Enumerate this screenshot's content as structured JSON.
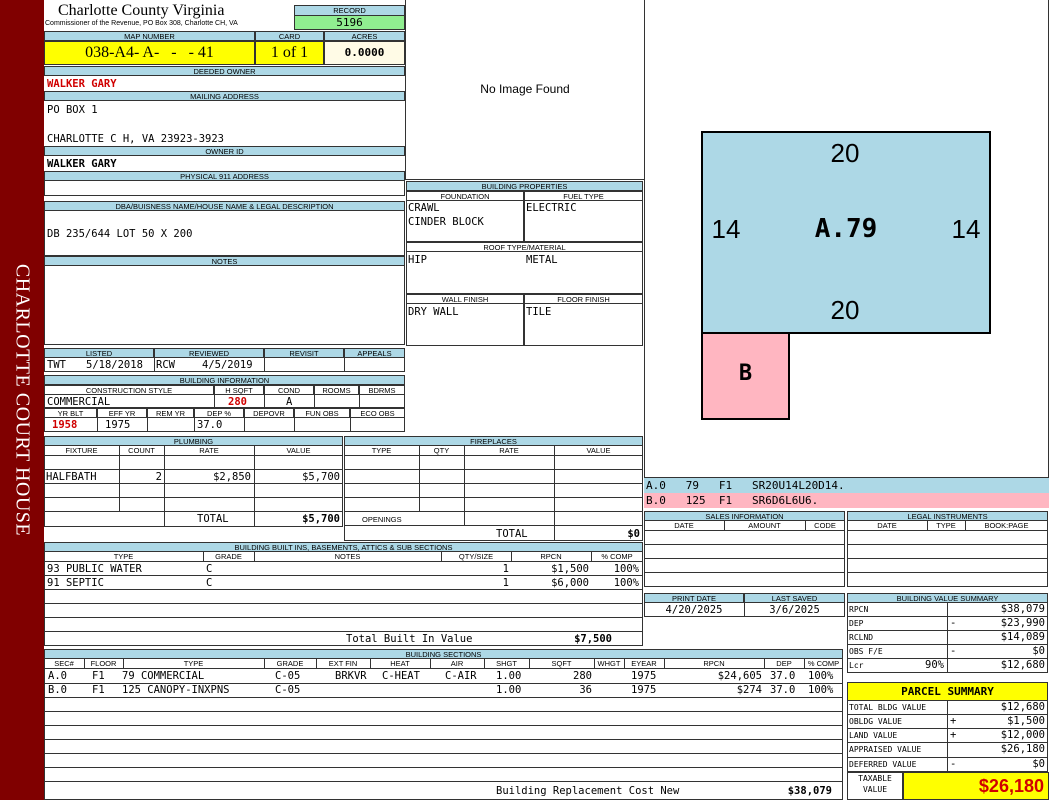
{
  "side_banner": "CHARLOTTE COURT HOUSE",
  "header": {
    "county": "Charlotte County Virginia",
    "commissioner": "Commissioner of the Revenue, PO Box 308, Charlotte CH, VA",
    "record_label": "RECORD",
    "record": "5196",
    "map_number_label": "MAP NUMBER",
    "map_number": "038-A4- A-   -   - 41",
    "card_label": "CARD",
    "card": "1 of 1",
    "acres_label": "ACRES",
    "acres": "0.0000"
  },
  "owner": {
    "deeded_label": "DEEDED OWNER",
    "deeded": "WALKER GARY",
    "mailing_label": "MAILING ADDRESS",
    "mailing_line1": "PO BOX 1",
    "mailing_line2": "CHARLOTTE C H, VA 23923-3923",
    "owner_id_label": "OWNER ID",
    "owner_id": "WALKER GARY",
    "physical_label": "PHYSICAL 911 ADDRESS",
    "physical": "",
    "dba_label": "DBA/BUISNESS NAME/HOUSE NAME & LEGAL DESCRIPTION",
    "dba": "DB 235/644 LOT 50 X 200",
    "notes_label": "NOTES"
  },
  "image": {
    "text": "No Image Found"
  },
  "building_properties": {
    "title": "BUILDING PROPERTIES",
    "foundation_label": "FOUNDATION",
    "foundation1": "CRAWL",
    "foundation2": "CINDER BLOCK",
    "fuel_label": "FUEL TYPE",
    "fuel": "ELECTRIC",
    "roof_label": "ROOF TYPE/MATERIAL",
    "roof_type": "HIP",
    "roof_material": "METAL",
    "wall_label": "WALL FINISH",
    "wall": "DRY WALL",
    "floor_label": "FLOOR FINISH",
    "floor": "TILE"
  },
  "sketch": {
    "top": "20",
    "bottom": "20",
    "left": "14",
    "right": "14",
    "main_label": "A.79",
    "sub_label": "B",
    "main_color": "#add8e6",
    "sub_color": "#ffb6c1"
  },
  "sketch_legend": [
    {
      "text": "A.0   79   F1   SR20U14L20D14."
    },
    {
      "text": "B.0   125  F1   SR6D6L6U6."
    }
  ],
  "listing": {
    "listed_label": "LISTED",
    "reviewed_label": "REVIEWED",
    "revisit_label": "REVISIT",
    "appeals_label": "APPEALS",
    "listed_by": "TWT",
    "listed_date": "5/18/2018",
    "reviewed_by": "RCW",
    "reviewed_date": "4/5/2019"
  },
  "building_info": {
    "title": "BUILDING INFORMATION",
    "construction_label": "CONSTRUCTION STYLE",
    "hsqft_label": "H SQFT",
    "cond_label": "COND",
    "rooms_label": "ROOMS",
    "bdrms_label": "BDRMS",
    "construction": "COMMERCIAL",
    "hsqft": "280",
    "cond": "A",
    "yrblt_label": "YR BLT",
    "effyr_label": "EFF YR",
    "remyr_label": "REM YR",
    "dep_label": "DEP %",
    "depovr_label": "DEPOVR",
    "funobs_label": "FUN OBS",
    "ecoobs_label": "ECO OBS",
    "yrblt": "1958",
    "effyr": "1975",
    "dep": "37.0"
  },
  "plumbing": {
    "title": "PLUMBING",
    "headers": [
      "FIXTURE",
      "COUNT",
      "RATE",
      "VALUE"
    ],
    "fixture": "HALFBATH",
    "count": "2",
    "rate": "$2,850",
    "value": "$5,700",
    "total_label": "TOTAL",
    "total": "$5,700"
  },
  "fireplaces": {
    "title": "FIREPLACES",
    "headers": [
      "TYPE",
      "QTY",
      "RATE",
      "VALUE"
    ],
    "openings_label": "OPENINGS",
    "total_label": "TOTAL",
    "total": "$0"
  },
  "sales": {
    "title": "SALES INFORMATION",
    "headers": [
      "DATE",
      "AMOUNT",
      "CODE"
    ]
  },
  "legal": {
    "title": "LEGAL INSTRUMENTS",
    "headers": [
      "DATE",
      "TYPE",
      "BOOK:PAGE"
    ]
  },
  "print": {
    "print_label": "PRINT DATE",
    "saved_label": "LAST SAVED",
    "print_date": "4/20/2025",
    "saved_date": "3/6/2025"
  },
  "built_ins": {
    "title": "BUILDING BUILT INS, BASEMENTS, ATTICS & SUB SECTIONS",
    "headers": [
      "TYPE",
      "GRADE",
      "NOTES",
      "QTY/SIZE",
      "RPCN",
      "% COMP"
    ],
    "rows": [
      {
        "type": "93 PUBLIC WATER",
        "grade": "C",
        "qty": "1",
        "rpcn": "$1,500",
        "comp": "100%"
      },
      {
        "type": "91 SEPTIC",
        "grade": "C",
        "qty": "1",
        "rpcn": "$6,000",
        "comp": "100%"
      }
    ],
    "total_label": "Total Built In Value",
    "total": "$7,500"
  },
  "sections": {
    "title": "BUILDING SECTIONS",
    "headers": [
      "SEC#",
      "FLOOR",
      "TYPE",
      "GRADE",
      "EXT FIN",
      "HEAT",
      "AIR",
      "SHGT",
      "SQFT",
      "WHGT",
      "EYEAR",
      "RPCN",
      "DEP",
      "% COMP"
    ],
    "rows": [
      {
        "sec": "A.0",
        "floor": "F1",
        "type": "79 COMMERCIAL",
        "grade": "C-05",
        "ext": "BRKVR",
        "heat": "C-HEAT",
        "air": "C-AIR",
        "shgt": "1.00",
        "sqft": "280",
        "eyear": "1975",
        "rpcn": "$24,605",
        "dep": "37.0",
        "comp": "100%"
      },
      {
        "sec": "B.0",
        "floor": "F1",
        "type": "125 CANOPY-INXPNS",
        "grade": "C-05",
        "ext": "",
        "heat": "",
        "air": "",
        "shgt": "1.00",
        "sqft": "36",
        "eyear": "1975",
        "rpcn": "$274",
        "dep": "37.0",
        "comp": "100%"
      }
    ],
    "replacement_label": "Building Replacement Cost New",
    "replacement": "$38,079"
  },
  "value_summary": {
    "title": "BUILDING VALUE SUMMARY",
    "rows": [
      {
        "label": "RPCN",
        "sign": "",
        "value": "$38,079"
      },
      {
        "label": "DEP",
        "sign": "-",
        "value": "$23,990"
      },
      {
        "label": "RCLND",
        "sign": "",
        "value": "$14,089"
      },
      {
        "label": "OBS F/E",
        "sign": "-",
        "value": "$0"
      },
      {
        "label": "Lcr",
        "sign": "90%",
        "value": "$12,680"
      }
    ]
  },
  "parcel": {
    "title": "PARCEL SUMMARY",
    "rows": [
      {
        "label": "TOTAL BLDG VALUE",
        "sign": "",
        "value": "$12,680"
      },
      {
        "label": "OBLDG VALUE",
        "sign": "+",
        "value": "$1,500"
      },
      {
        "label": "LAND VALUE",
        "sign": "+",
        "value": "$12,000"
      },
      {
        "label": "APPRAISED VALUE",
        "sign": "",
        "value": "$26,180"
      },
      {
        "label": "DEFERRED VALUE",
        "sign": "-",
        "value": "$0"
      }
    ],
    "taxable_label1": "TAXABLE",
    "taxable_label2": "VALUE",
    "taxable": "$26,180"
  }
}
